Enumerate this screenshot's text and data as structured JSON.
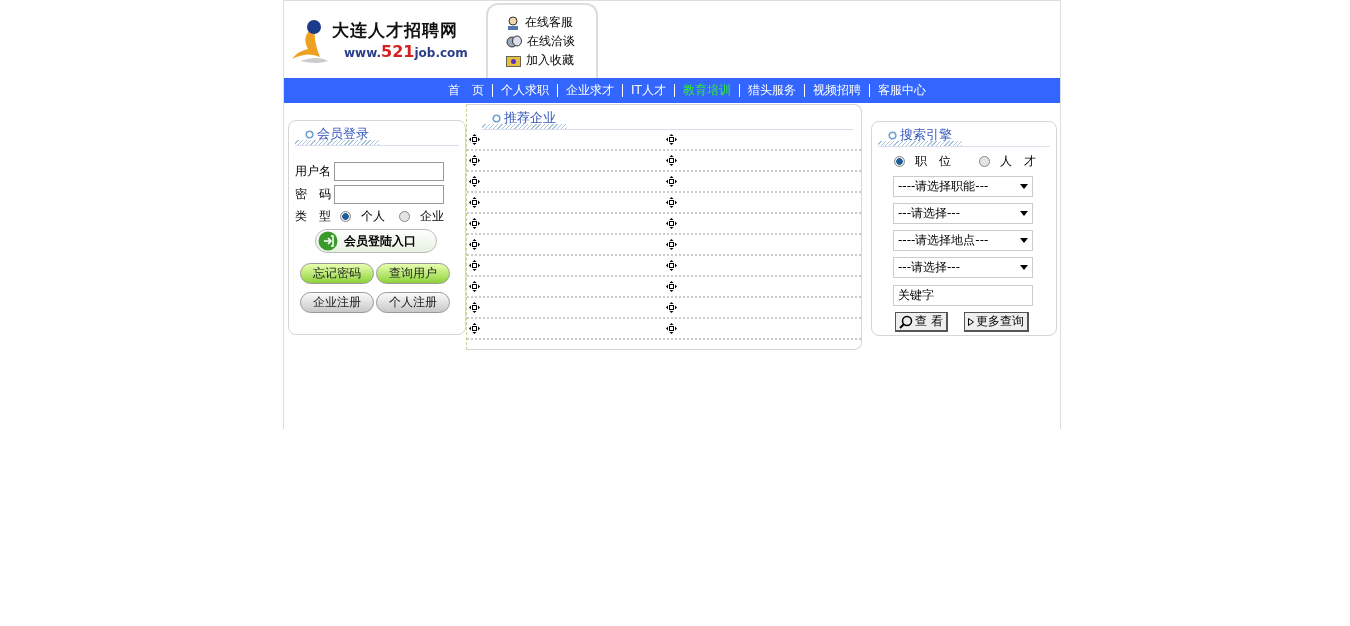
{
  "logo": {
    "title": "大连人才招聘网",
    "url_prefix": "www.",
    "url_number": "521",
    "url_suffix": "job.com"
  },
  "quick_links": [
    {
      "kind": "service",
      "label": "在线客服"
    },
    {
      "kind": "chat",
      "label": "在线洽谈"
    },
    {
      "kind": "favorite",
      "label": "加入收藏"
    }
  ],
  "nav": [
    {
      "label": "首　页",
      "selected": false
    },
    {
      "label": "个人求职",
      "selected": false
    },
    {
      "label": "企业求才",
      "selected": false
    },
    {
      "label": "IT人才",
      "selected": false
    },
    {
      "label": "教育培训",
      "selected": true
    },
    {
      "label": "猎头服务",
      "selected": false
    },
    {
      "label": "视频招聘",
      "selected": false
    },
    {
      "label": "客服中心",
      "selected": false
    }
  ],
  "login": {
    "title": "会员登录",
    "fields": [
      {
        "label": "用户名"
      },
      {
        "label": "密　码"
      }
    ],
    "type_label": "类　型",
    "types": [
      {
        "label": "个人",
        "selected": true
      },
      {
        "label": "企业",
        "selected": false
      }
    ],
    "submit": "会员登陆入口",
    "buttons": [
      {
        "kind": "green",
        "label": "忘记密码"
      },
      {
        "kind": "green",
        "label": "查询用户"
      },
      {
        "kind": "grey",
        "label": "企业注册"
      },
      {
        "kind": "grey",
        "label": "个人注册"
      }
    ]
  },
  "recommended": {
    "title": "推荐企业",
    "rows": [
      {
        "cells": [
          {
            "kind": "blank"
          },
          {
            "kind": "blank"
          }
        ]
      },
      {
        "cells": [
          {
            "kind": "blank"
          },
          {
            "kind": "blank"
          }
        ]
      },
      {
        "cells": [
          {
            "kind": "blank"
          },
          {
            "kind": "blank"
          }
        ]
      },
      {
        "cells": [
          {
            "kind": "blank"
          },
          {
            "kind": "blank"
          }
        ]
      },
      {
        "cells": [
          {
            "kind": "blank"
          },
          {
            "kind": "blank"
          }
        ]
      },
      {
        "cells": [
          {
            "kind": "blank"
          },
          {
            "kind": "blank"
          }
        ]
      },
      {
        "cells": [
          {
            "kind": "blank"
          },
          {
            "kind": "blank"
          }
        ]
      },
      {
        "cells": [
          {
            "kind": "blank"
          },
          {
            "kind": "blank"
          }
        ]
      },
      {
        "cells": [
          {
            "kind": "blank"
          },
          {
            "kind": "blank"
          }
        ]
      },
      {
        "cells": [
          {
            "kind": "blank"
          },
          {
            "kind": "blank"
          }
        ]
      }
    ]
  },
  "search": {
    "title": "搜索引擎",
    "modes": [
      {
        "label": "职　位",
        "selected": true
      },
      {
        "label": "人　才",
        "selected": false
      }
    ],
    "selects": [
      "----请选择职能---",
      "---请选择---",
      "----请选择地点---",
      "---请选择---"
    ],
    "keyword": {
      "value": "关键字"
    },
    "buttons": [
      {
        "kind": "search",
        "label": "查 看"
      },
      {
        "kind": "more",
        "label": "更多查询"
      }
    ]
  }
}
